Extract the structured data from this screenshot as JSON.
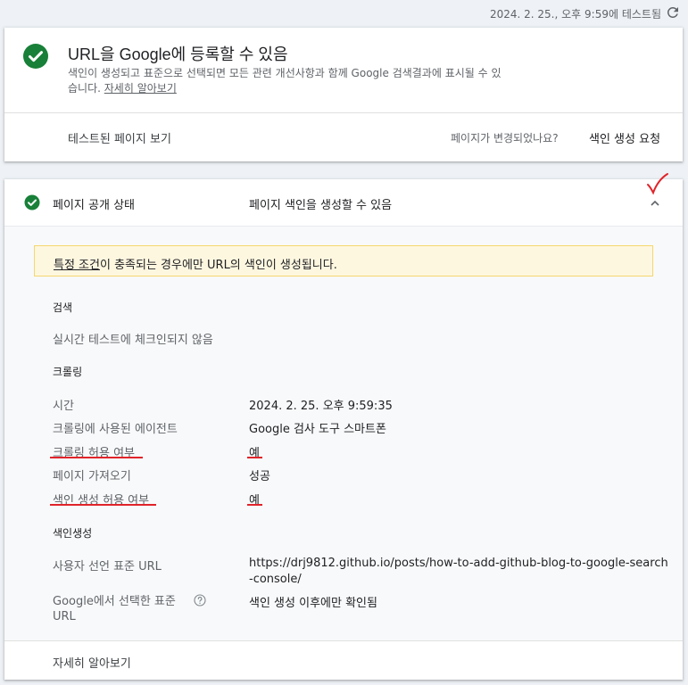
{
  "topbar": {
    "timestamp": "2024. 2. 25., 오후 9:59에 테스트됨",
    "refresh_icon": "refresh-icon"
  },
  "summary": {
    "title": "URL을 Google에 등록할 수 있음",
    "desc_text": "색인이 생성되고 표준으로 선택되면 모든 관련 개선사항과 함께 Google 검색결과에 표시될 수 있습니다.",
    "learn_more": "자세히 알아보기",
    "view_tested": "테스트된 페이지 보기",
    "changed_q": "페이지가 변경되었나요?",
    "request_index": "색인 생성 요청",
    "icon": "check-circle-icon",
    "accent": "#188038"
  },
  "availability": {
    "label": "페이지 공개 상태",
    "value": "페이지 색인을 생성할 수 있음",
    "warn_link": "특정 조건",
    "warn_rest": "이 충족되는 경우에만 URL의 색인이 생성됩니다.",
    "search_heading": "검색",
    "search_value": "실시간 테스트에 체크인되지 않음",
    "crawl_heading": "크롤링",
    "rows": [
      {
        "label": "시간",
        "value": "2024. 2. 25. 오후 9:59:35"
      },
      {
        "label": "크롤링에 사용된 에이전트",
        "value": "Google 검사 도구 스마트폰"
      },
      {
        "label": "크롤링 허용 여부",
        "value": "예"
      },
      {
        "label": "페이지 가져오기",
        "value": "성공"
      },
      {
        "label": "색인 생성 허용 여부",
        "value": "예"
      }
    ],
    "index_heading": "색인생성",
    "canonical_user_label": "사용자 선언 표준 URL",
    "canonical_user_value": "https://drj9812.github.io/posts/how-to-add-github-blog-to-google-search-console/",
    "canonical_google_label": "Google에서 선택한 표준 URL",
    "canonical_google_value": "색인 생성 이후에만 확인됨",
    "learn_more": "자세히 알아보기",
    "annotation_color": "#e0242a"
  }
}
